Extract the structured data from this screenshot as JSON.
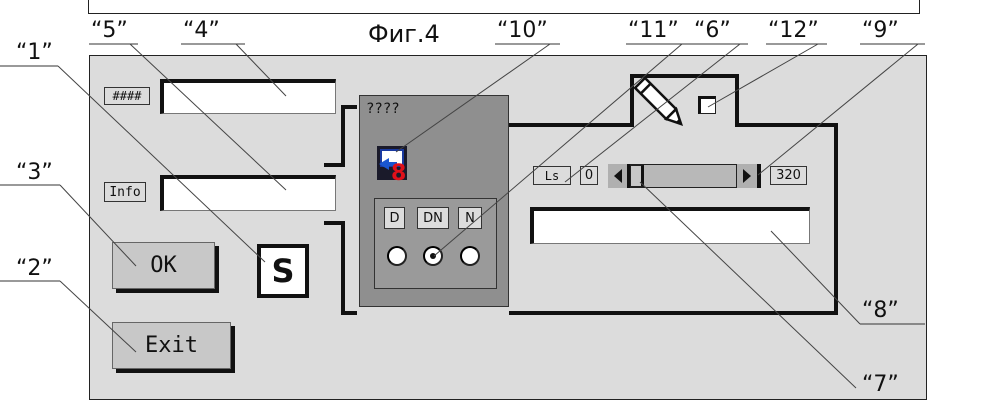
{
  "figure_title": "Фиг.4",
  "callouts": {
    "c1": "“1”",
    "c2": "“2”",
    "c3": "“3”",
    "c4": "“4”",
    "c5": "“5”",
    "c6": "“6”",
    "c7": "“7”",
    "c8": "“8”",
    "c9": "“9”",
    "c10": "“10”",
    "c11": "“11”",
    "c12": "“12”"
  },
  "form": {
    "hash_label": "####",
    "info_label": "Info",
    "ok_label": "OK",
    "exit_label": "Exit",
    "s_button": "S",
    "group_title": "????",
    "toggle_buttons": [
      "D",
      "DN",
      "N"
    ],
    "ls_label": "Ls",
    "slider_min": "0",
    "slider_max": "320",
    "slider_value": 0
  }
}
